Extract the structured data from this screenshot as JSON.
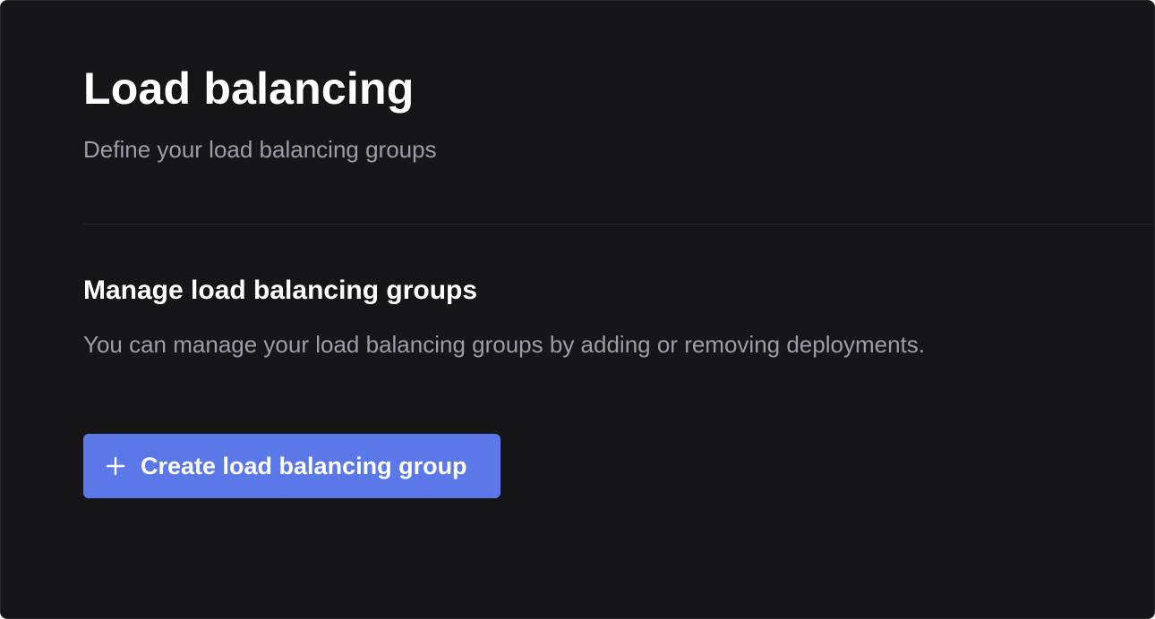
{
  "header": {
    "title": "Load balancing",
    "subtitle": "Define your load balancing groups"
  },
  "section": {
    "title": "Manage load balancing groups",
    "description": "You can manage your load balancing groups by adding or removing deployments."
  },
  "actions": {
    "create_label": "Create load balancing group",
    "create_icon": "plus-icon"
  },
  "colors": {
    "background": "#161618",
    "primary_text": "#ffffff",
    "secondary_text": "#9d9da6",
    "accent": "#5a78e8",
    "divider": "#222226"
  }
}
